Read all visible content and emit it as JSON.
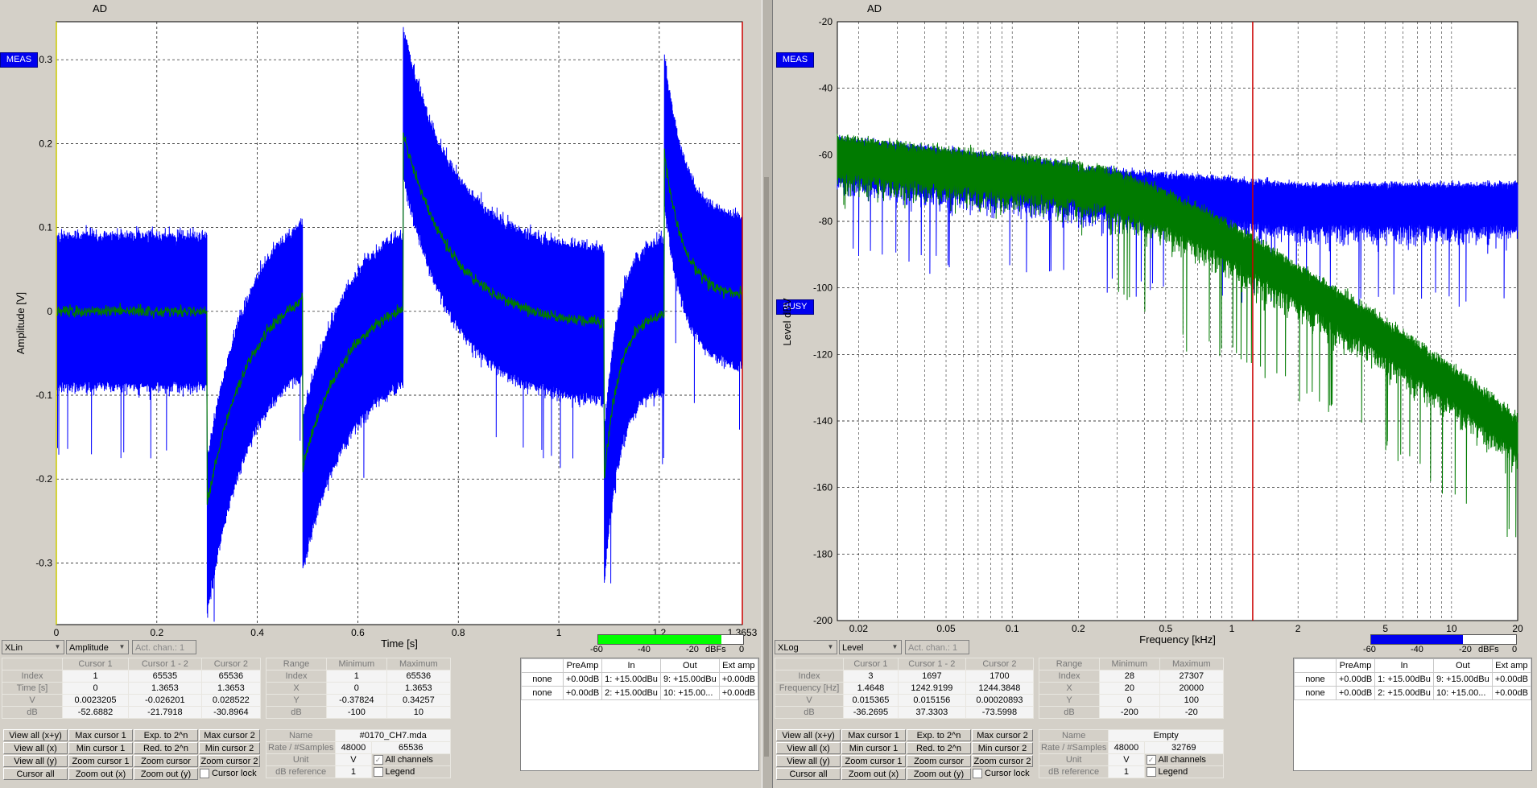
{
  "left": {
    "title": "AD",
    "meas_badge": "MEAS",
    "plot": {
      "ylabel": "Amplitude [V]",
      "xlabel": "Time [s]",
      "yticks": [
        "0.3",
        "0.2",
        "0.1",
        "0",
        "-0.1",
        "-0.2",
        "-0.3"
      ],
      "xticks": [
        "0",
        "0.2",
        "0.4",
        "0.6",
        "0.8",
        "1",
        "1.2",
        "1.3653"
      ]
    },
    "meter": {
      "ticks": [
        "-60",
        "-40",
        "-20",
        "dBFs",
        "0"
      ],
      "level_db": -9,
      "color": "#00ff00"
    },
    "controls": {
      "xaxis": "XLin",
      "yaxis": "Amplitude",
      "act_chan": "Act. chan.: 1"
    },
    "cursor_table": {
      "headers": [
        "Cursor 1",
        "Cursor 1 - 2",
        "Cursor 2"
      ],
      "rows": [
        {
          "label": "Index",
          "values": [
            "1",
            "65535",
            "65536"
          ]
        },
        {
          "label": "Time [s]",
          "values": [
            "0",
            "1.3653",
            "1.3653"
          ]
        },
        {
          "label": "V",
          "values": [
            "0.0023205",
            "-0.026201",
            "0.028522"
          ]
        },
        {
          "label": "dB",
          "values": [
            "-52.6882",
            "-21.7918",
            "-30.8964"
          ]
        }
      ]
    },
    "range_table": {
      "headers": [
        "Range",
        "Minimum",
        "Maximum"
      ],
      "rows": [
        {
          "label": "Index",
          "values": [
            "1",
            "65536"
          ]
        },
        {
          "label": "X",
          "values": [
            "0",
            "1.3653"
          ]
        },
        {
          "label": "Y",
          "values": [
            "-0.37824",
            "0.34257"
          ]
        },
        {
          "label": "dB",
          "values": [
            "-100",
            "10"
          ]
        }
      ]
    },
    "buttons": [
      [
        "View all (x+y)",
        "Max cursor 1",
        "Exp. to 2^n",
        "Max cursor 2"
      ],
      [
        "View all (x)",
        "Min cursor 1",
        "Red. to 2^n",
        "Min cursor 2"
      ],
      [
        "View all (y)",
        "Zoom cursor 1",
        "Zoom cursor",
        "Zoom cursor 2"
      ],
      [
        "Cursor all",
        "Zoom out (x)",
        "Zoom out (y)",
        "Cursor lock"
      ]
    ],
    "info": {
      "name_label": "Name",
      "name": "#0170_CH7.mda",
      "rate_label": "Rate / #Samples",
      "rate": "48000",
      "samples": "65536",
      "unit_label": "Unit",
      "unit": "V",
      "all_channels": "All channels",
      "dbref_label": "dB reference",
      "dbref": "1",
      "legend": "Legend"
    },
    "channels": {
      "headers": [
        "PreAmp",
        "In",
        "Out",
        "Ext amp"
      ],
      "rows": [
        {
          "name": "none",
          "preamp": "+0.00dB",
          "in": "1: +15.00dBu",
          "out": "9: +15.00dBu",
          "ext": "+0.00dB"
        },
        {
          "name": "none",
          "preamp": "+0.00dB",
          "in": "2: +15.00dBu",
          "out": "10: +15.00...",
          "ext": "+0.00dB"
        }
      ]
    }
  },
  "right": {
    "title": "AD",
    "meas_badge": "MEAS",
    "busy_badge": "BUSY",
    "plot": {
      "ylabel": "Level dBV",
      "xlabel": "Frequency [kHz]",
      "yticks": [
        "-20",
        "-40",
        "-60",
        "-80",
        "-100",
        "-120",
        "-140",
        "-160",
        "-180",
        "-200"
      ],
      "xticks": [
        "0.02",
        "0.05",
        "0.1",
        "0.2",
        "0.5",
        "1",
        "2",
        "5",
        "10",
        "20"
      ]
    },
    "meter": {
      "ticks": [
        "-60",
        "-40",
        "-20",
        "dBFs",
        "0"
      ],
      "level_db": -22,
      "color": "#0000ee"
    },
    "controls": {
      "xaxis": "XLog",
      "yaxis": "Level",
      "act_chan": "Act. chan.: 1"
    },
    "cursor_table": {
      "headers": [
        "Cursor 1",
        "Cursor 1 - 2",
        "Cursor 2"
      ],
      "rows": [
        {
          "label": "Index",
          "values": [
            "3",
            "1697",
            "1700"
          ]
        },
        {
          "label": "Frequency [Hz]",
          "values": [
            "1.4648",
            "1242.9199",
            "1244.3848"
          ]
        },
        {
          "label": "V",
          "values": [
            "0.015365",
            "0.015156",
            "0.00020893"
          ]
        },
        {
          "label": "dB",
          "values": [
            "-36.2695",
            "37.3303",
            "-73.5998"
          ]
        }
      ]
    },
    "range_table": {
      "headers": [
        "Range",
        "Minimum",
        "Maximum"
      ],
      "rows": [
        {
          "label": "Index",
          "values": [
            "28",
            "27307"
          ]
        },
        {
          "label": "X",
          "values": [
            "20",
            "20000"
          ]
        },
        {
          "label": "Y",
          "values": [
            "0",
            "100"
          ]
        },
        {
          "label": "dB",
          "values": [
            "-200",
            "-20"
          ]
        }
      ]
    },
    "buttons": [
      [
        "View all (x+y)",
        "Max cursor 1",
        "Exp. to 2^n",
        "Max cursor 2"
      ],
      [
        "View all (x)",
        "Min cursor 1",
        "Red. to 2^n",
        "Min cursor 2"
      ],
      [
        "View all (y)",
        "Zoom cursor 1",
        "Zoom cursor",
        "Zoom cursor 2"
      ],
      [
        "Cursor all",
        "Zoom out (x)",
        "Zoom out (y)",
        "Cursor lock"
      ]
    ],
    "info": {
      "name_label": "Name",
      "name": "Empty",
      "rate_label": "Rate / #Samples",
      "rate": "48000",
      "samples": "32769",
      "unit_label": "Unit",
      "unit": "V",
      "all_channels": "All channels",
      "dbref_label": "dB reference",
      "dbref": "1",
      "legend": "Legend"
    },
    "channels": {
      "headers": [
        "PreAmp",
        "In",
        "Out",
        "Ext amp"
      ],
      "rows": [
        {
          "name": "none",
          "preamp": "+0.00dB",
          "in": "1: +15.00dBu",
          "out": "9: +15.00dBu",
          "ext": "+0.00dB"
        },
        {
          "name": "none",
          "preamp": "+0.00dB",
          "in": "2: +15.00dBu",
          "out": "10: +15.00...",
          "ext": "+0.00dB"
        }
      ]
    }
  },
  "colors": {
    "signal_raw": "#0000ff",
    "signal_filtered": "#007a00",
    "cursor": "#cc0000",
    "cursor_left": "#cccc00"
  }
}
